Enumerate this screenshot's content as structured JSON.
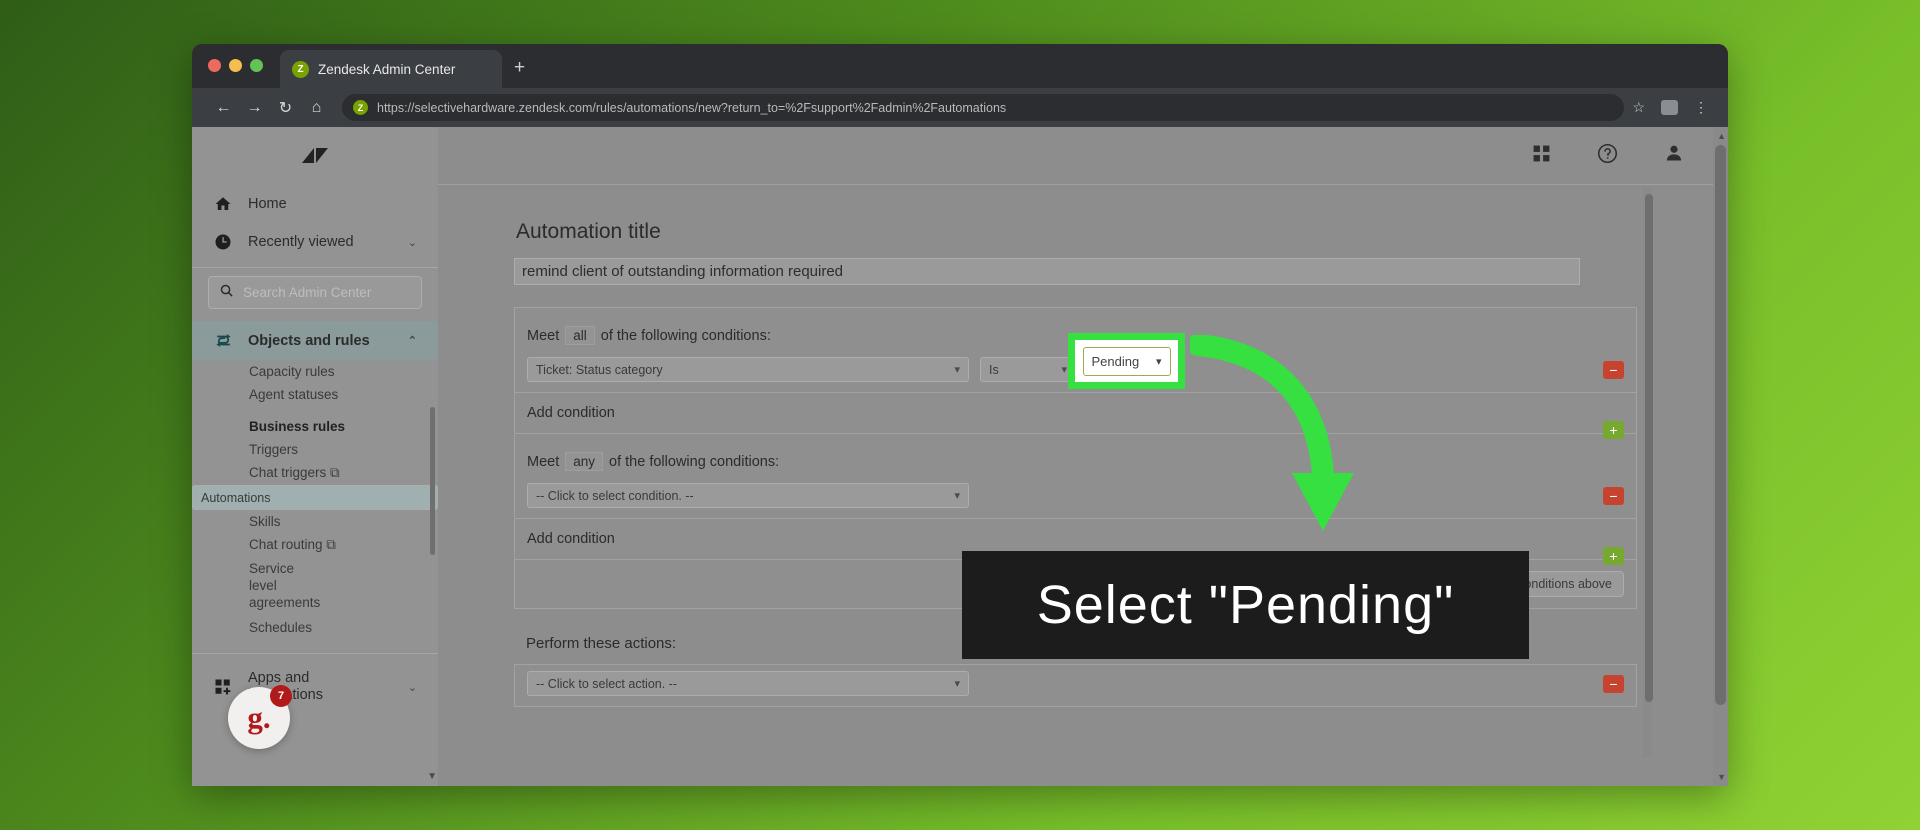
{
  "browser": {
    "tab": {
      "title": "Zendesk Admin Center",
      "favicon": "zendesk-icon",
      "favicon_glyph": "Z"
    },
    "new_tab_label": "+",
    "nav": {
      "back": "←",
      "forward": "→",
      "reload": "↻",
      "home": "⌂"
    },
    "url": "https://selectivehardware.zendesk.com/rules/automations/new?return_to=%2Fsupport%2Fadmin%2Fautomations",
    "star_icon": "☆",
    "menu_icon": "⋮"
  },
  "sidebar": {
    "logo": "zendesk-logo",
    "primary": [
      {
        "label": "Home",
        "icon": "home-icon"
      },
      {
        "label": "Recently viewed",
        "icon": "clock-icon",
        "chevron": "⌄"
      }
    ],
    "search": {
      "placeholder": "Search Admin Center",
      "icon": "search-icon"
    },
    "section": {
      "label": "Objects and rules",
      "icon": "objects-rules-icon",
      "chevron": "⌃"
    },
    "items": [
      {
        "label": "Capacity rules",
        "type": "link"
      },
      {
        "label": "Agent statuses",
        "type": "link"
      },
      {
        "label": "Business rules",
        "type": "heading"
      },
      {
        "label": "Triggers",
        "type": "link"
      },
      {
        "label": "Chat triggers ⧉",
        "type": "link"
      },
      {
        "label": "Automations",
        "type": "link",
        "selected": true
      },
      {
        "label": "Skills",
        "type": "link"
      },
      {
        "label": "Chat routing ⧉",
        "type": "link"
      },
      {
        "label": "Service level agreements",
        "type": "link"
      },
      {
        "label": "Schedules",
        "type": "link"
      }
    ],
    "footer": {
      "label": "Apps and integrations",
      "icon": "apps-icon",
      "chevron": "⌄"
    }
  },
  "header": {
    "grid_icon": "grid-apps-icon",
    "help_icon": "help-circle-icon",
    "user_icon": "user-avatar-icon"
  },
  "form": {
    "title_label": "Automation title",
    "title_value": "remind client of outstanding information required",
    "conditions_all": {
      "meet_prefix": "Meet",
      "operator": "all",
      "meet_suffix": "of the following conditions:",
      "rows": [
        {
          "condition": "Ticket: Status category",
          "operator": "Is",
          "value": "Pending"
        }
      ],
      "add_label": "Add condition",
      "remove_icon": "−",
      "add_icon": "+"
    },
    "conditions_any": {
      "meet_prefix": "Meet",
      "operator": "any",
      "meet_suffix": "of the following conditions:",
      "rows": [
        {
          "condition": "-- Click to select condition. --"
        }
      ],
      "add_label": "Add condition",
      "remove_icon": "−",
      "add_icon": "+"
    },
    "preview_button": "Preview match for the conditions above",
    "actions_label": "Perform these actions:",
    "action_placeholder": "-- Click to select action. --",
    "action_remove_icon": "−"
  },
  "annotation": {
    "callout_text": "Select  \"Pending\"",
    "highlight_color": "#35e040",
    "highlight_target": "Pending",
    "arrow": "curved-down-arrow"
  },
  "grammarly": {
    "glyph": "g.",
    "badge_count": "7"
  }
}
